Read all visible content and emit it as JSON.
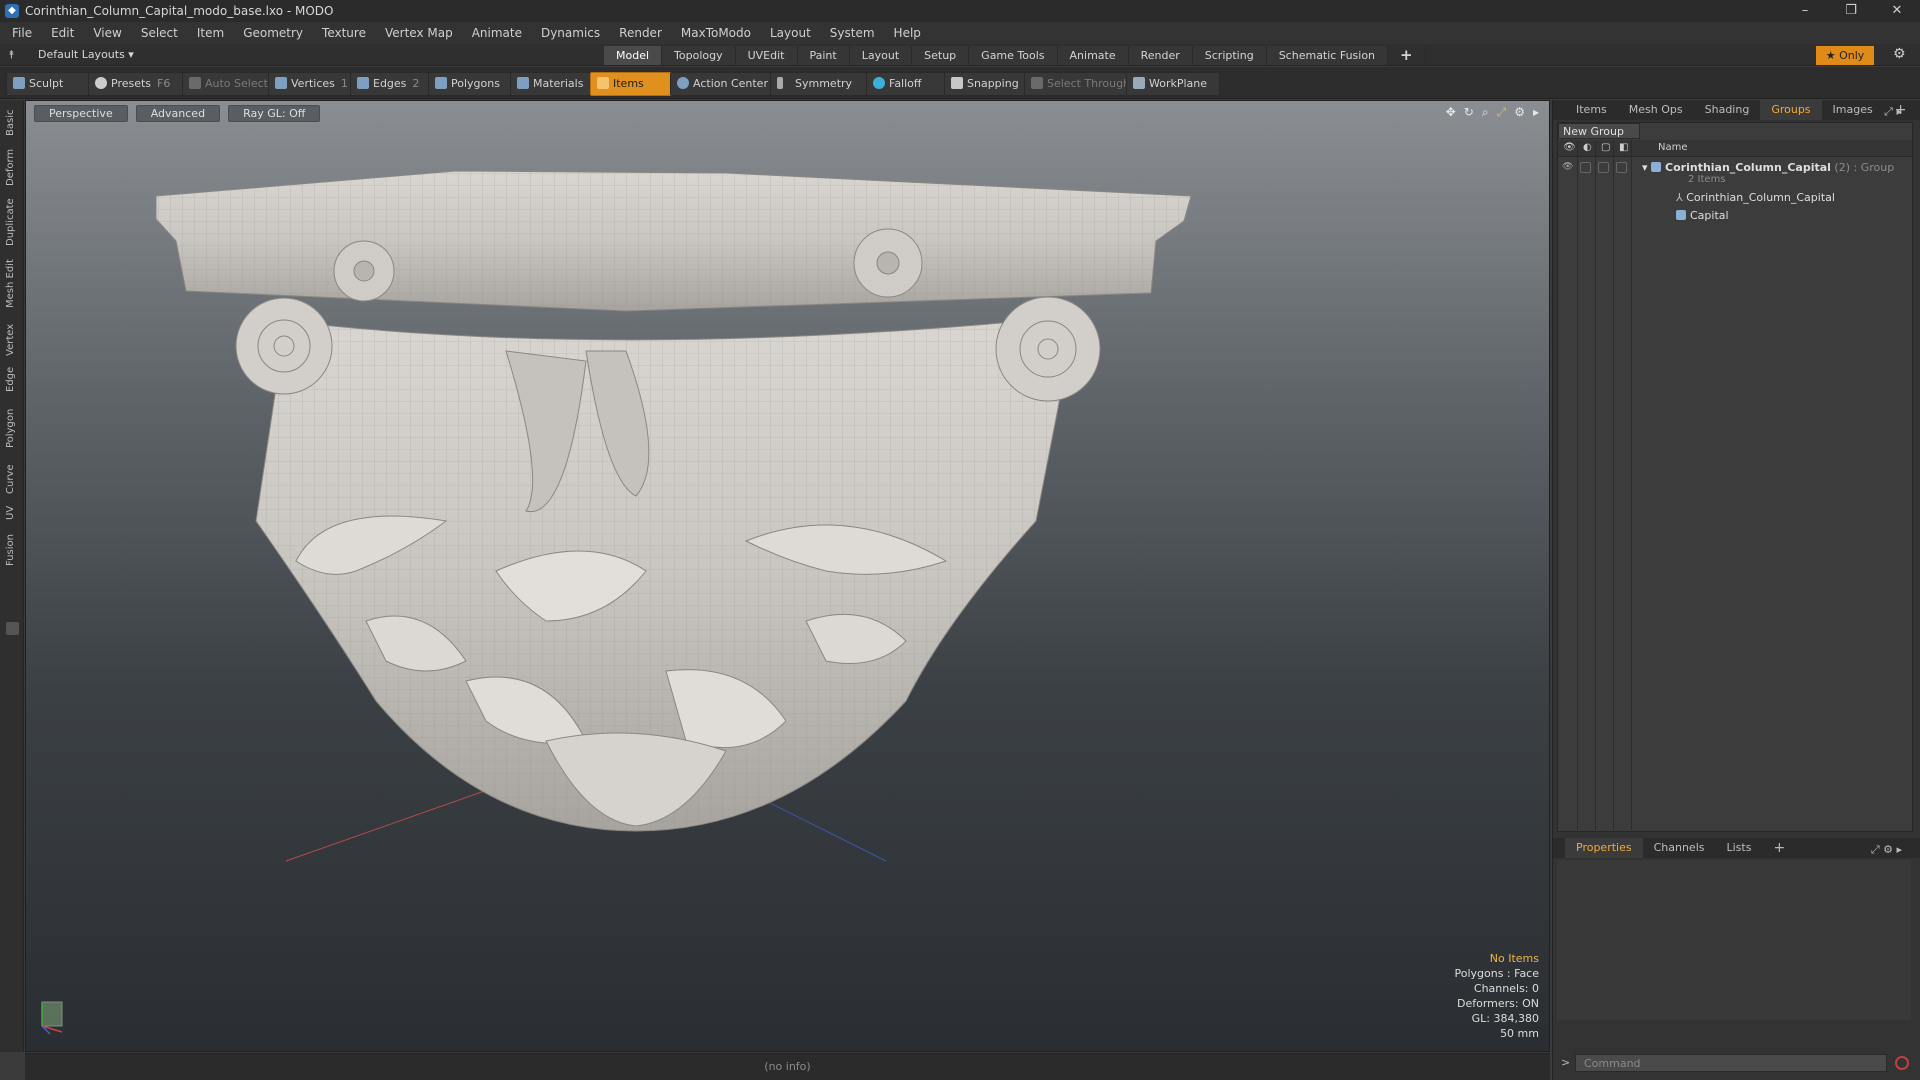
{
  "window": {
    "title": "Corinthian_Column_Capital_modo_base.lxo - MODO",
    "app_icon": "modo-logo-icon",
    "controls": [
      "–",
      "❐",
      "✕"
    ]
  },
  "menu": [
    "File",
    "Edit",
    "View",
    "Select",
    "Item",
    "Geometry",
    "Texture",
    "Vertex Map",
    "Animate",
    "Dynamics",
    "Render",
    "MaxToModo",
    "Layout",
    "System",
    "Help"
  ],
  "layout_bar": {
    "layout_dropdown": "Default Layouts ▾",
    "tabs": [
      "Model",
      "Topology",
      "UVEdit",
      "Paint",
      "Layout",
      "Setup",
      "Game Tools",
      "Animate",
      "Render",
      "Scripting",
      "Schematic Fusion"
    ],
    "active_tab": "Model",
    "add_tab": "+",
    "only_label": "★ Only"
  },
  "toolbar": {
    "sculpt": "Sculpt",
    "presets": "Presets",
    "presets_key": "F6",
    "auto_select": "Auto Select",
    "vertices": "Vertices",
    "vertices_count": "1",
    "edges": "Edges",
    "edges_count": "2",
    "polygons": "Polygons",
    "materials": "Materials",
    "items": "Items",
    "action_center": "Action Center",
    "symmetry": "Symmetry",
    "falloff": "Falloff",
    "snapping": "Snapping",
    "select_through": "Select Through",
    "workplane": "WorkPlane"
  },
  "left_tabs": [
    "Basic",
    "Deform",
    "Duplicate",
    "Mesh Edit",
    "Vertex",
    "Edge",
    "Polygon",
    "Curve",
    "UV",
    "Fusion"
  ],
  "viewport": {
    "tabs": [
      "Perspective",
      "Advanced",
      "Ray GL: Off"
    ],
    "info": {
      "selection": "No Items",
      "polygons": "Polygons : Face",
      "channels": "Channels: 0",
      "deformers": "Deformers: ON",
      "gl": "GL: 384,380",
      "scale": "50 mm"
    }
  },
  "status_bar": {
    "info": "(no info)"
  },
  "right_panel": {
    "top_tabs": [
      "Items",
      "Mesh Ops",
      "Shading",
      "Groups",
      "Images"
    ],
    "active_top_tab": "Groups",
    "new_group": "New Group",
    "column_name": "Name",
    "tree": {
      "group_name": "Corinthian_Column_Capital",
      "group_suffix": "(2) : Group",
      "group_count": "2 Items",
      "children": [
        "Corinthian_Column_Capital",
        "Capital"
      ]
    },
    "bottom_tabs": [
      "Properties",
      "Channels",
      "Lists"
    ],
    "active_bottom_tab": "Properties",
    "command_placeholder": "Command"
  },
  "colors": {
    "accent_orange": "#e0901f",
    "active_tab_text": "#f2a93b",
    "info_highlight": "#f4b33e"
  }
}
